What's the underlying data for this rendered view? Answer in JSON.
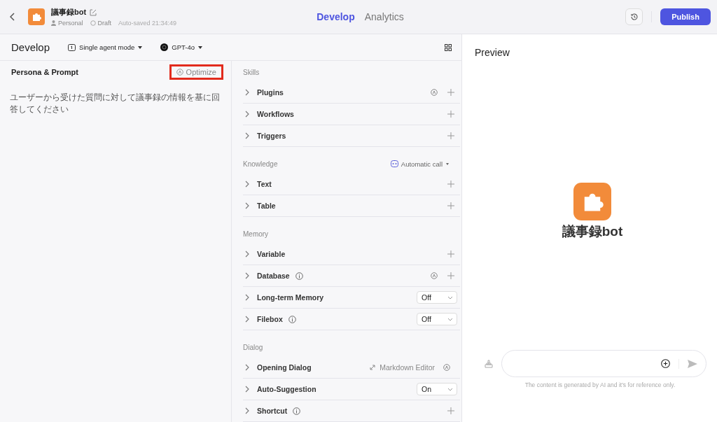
{
  "header": {
    "title": "議事録bot",
    "space": "Personal",
    "status": "Draft",
    "saved": "Auto-saved 21:34:49",
    "publish": "Publish"
  },
  "tabs": [
    {
      "label": "Develop",
      "selected": true
    },
    {
      "label": "Analytics",
      "selected": false
    }
  ],
  "develop": {
    "title": "Develop",
    "mode": "Single agent mode",
    "model": "GPT-4o"
  },
  "prompt": {
    "title": "Persona & Prompt",
    "optimize": "Optimize",
    "highlighted": true,
    "value": "ユーザーから受けた質問に対して議事録の情報を基に回答してください"
  },
  "sections": [
    {
      "title": "Skills",
      "rows": [
        {
          "label": "Plugins",
          "kind": "add",
          "info": false,
          "auto": true
        },
        {
          "label": "Workflows",
          "kind": "add",
          "info": false,
          "auto": false
        },
        {
          "label": "Triggers",
          "kind": "add",
          "info": false,
          "auto": false
        }
      ]
    },
    {
      "title": "Knowledge",
      "mode": "Automatic call",
      "rows": [
        {
          "label": "Text",
          "kind": "add",
          "info": false,
          "auto": false
        },
        {
          "label": "Table",
          "kind": "add",
          "info": false,
          "auto": false
        }
      ]
    },
    {
      "title": "Memory",
      "rows": [
        {
          "label": "Variable",
          "kind": "add",
          "info": false,
          "auto": false
        },
        {
          "label": "Database",
          "kind": "add",
          "info": true,
          "auto": true
        },
        {
          "label": "Long-term Memory",
          "kind": "select",
          "info": false,
          "auto": false,
          "value": "Off"
        },
        {
          "label": "Filebox",
          "kind": "select",
          "info": true,
          "auto": false,
          "value": "Off"
        }
      ]
    },
    {
      "title": "Dialog",
      "rows": [
        {
          "label": "Opening Dialog",
          "kind": "editor",
          "info": false,
          "auto": true,
          "link": "Markdown Editor"
        },
        {
          "label": "Auto-Suggestion",
          "kind": "select",
          "info": false,
          "auto": false,
          "value": "On"
        },
        {
          "label": "Shortcut",
          "kind": "add",
          "info": true,
          "auto": false
        }
      ]
    }
  ],
  "preview": {
    "title": "Preview",
    "bot_name": "議事録bot",
    "disclaimer": "The content is generated by AI and it's for reference only."
  }
}
